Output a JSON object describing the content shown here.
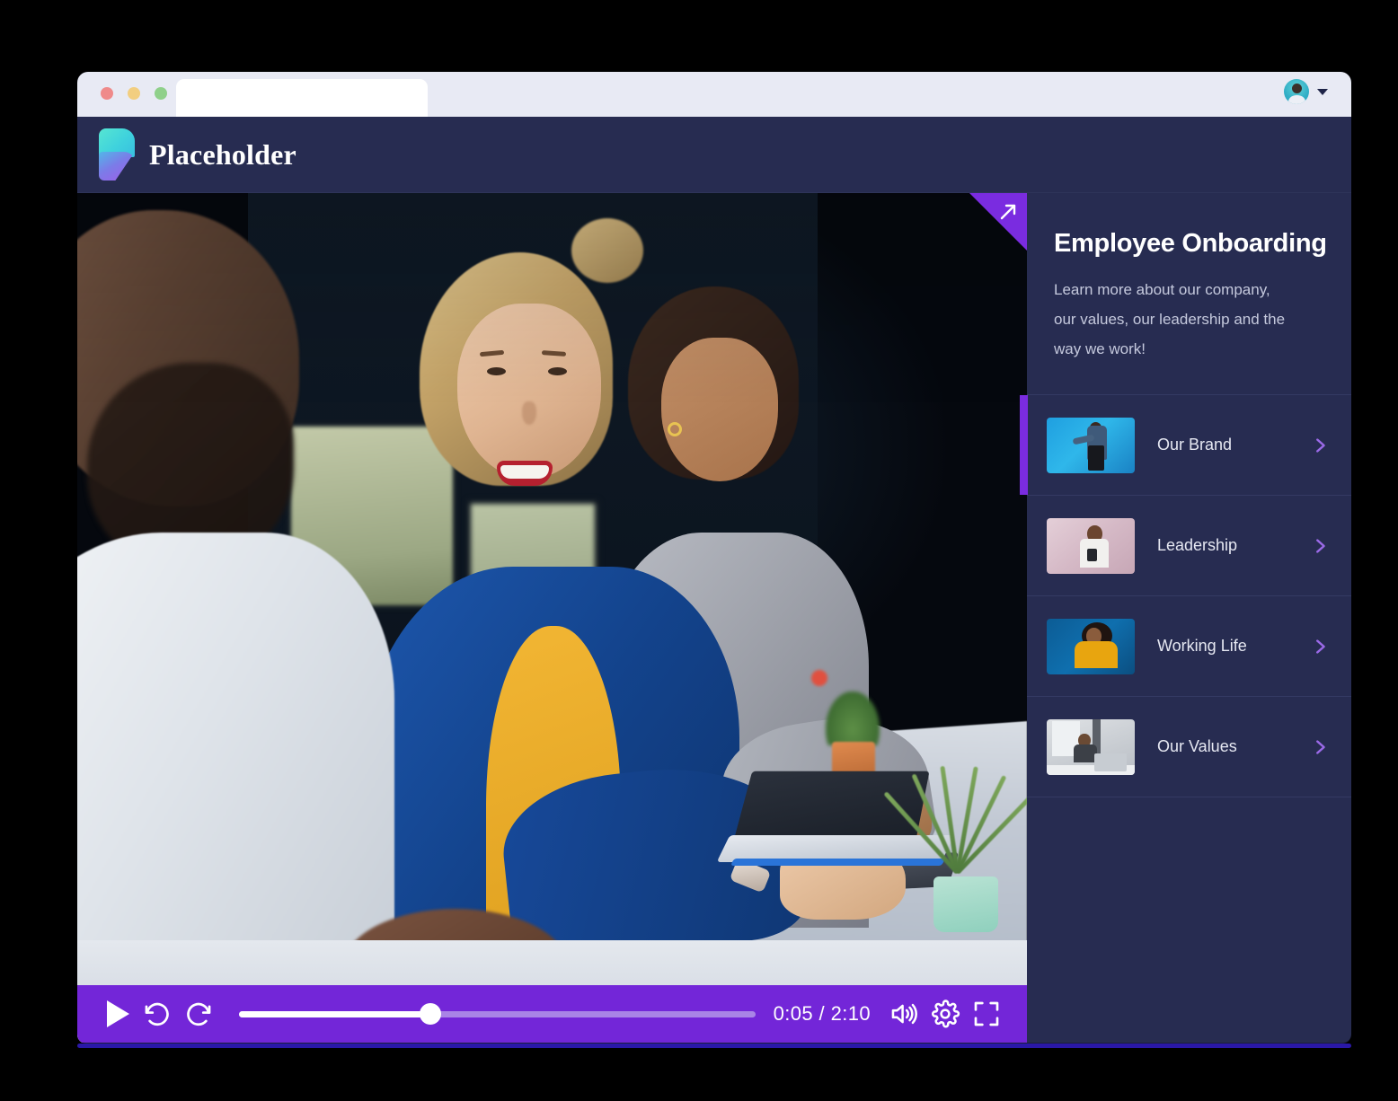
{
  "browser": {
    "tab_title": "",
    "traffic_lights": [
      "close-red",
      "minimize-yellow",
      "maximize-green"
    ],
    "profile": {
      "avatar_alt": "User avatar",
      "menu_icon": "chevron-down-icon"
    }
  },
  "header": {
    "brand_name": "Placeholder",
    "logo_icon": "placeholder-logo-icon"
  },
  "video": {
    "expand_icon": "expand-arrow-icon",
    "controls": {
      "play_icon": "play-icon",
      "rewind_icon": "rewind-10-icon",
      "forward_icon": "forward-10-icon",
      "current_time": "0:05",
      "total_time": "2:10",
      "time_display": "0:05 / 2:10",
      "progress_percent": 37,
      "volume_icon": "volume-high-icon",
      "settings_icon": "gear-icon",
      "fullscreen_icon": "fullscreen-icon"
    }
  },
  "sidebar": {
    "title": "Employee Onboarding",
    "description_lines": [
      "Learn more about our company,",
      "our values, our leadership and the",
      "way we work!"
    ],
    "chapters": [
      {
        "label": "Our Brand",
        "thumb": "woman-presenting-blue-backdrop",
        "active": true,
        "chevron": "chevron-right-icon"
      },
      {
        "label": "Leadership",
        "thumb": "man-with-phone-pink-backdrop",
        "active": false,
        "chevron": "chevron-right-icon"
      },
      {
        "label": "Working Life",
        "thumb": "woman-yellow-sweater-blue-backdrop",
        "active": false,
        "chevron": "chevron-right-icon"
      },
      {
        "label": "Our Values",
        "thumb": "person-at-laptop-office",
        "active": false,
        "chevron": "chevron-right-icon"
      }
    ]
  },
  "colors": {
    "navy": "#272c51",
    "purple_accent": "#7a2ce0",
    "control_bar": "#7326d8",
    "chrome": "#e8eaf4",
    "bottom_accent": "#2a18a8"
  }
}
